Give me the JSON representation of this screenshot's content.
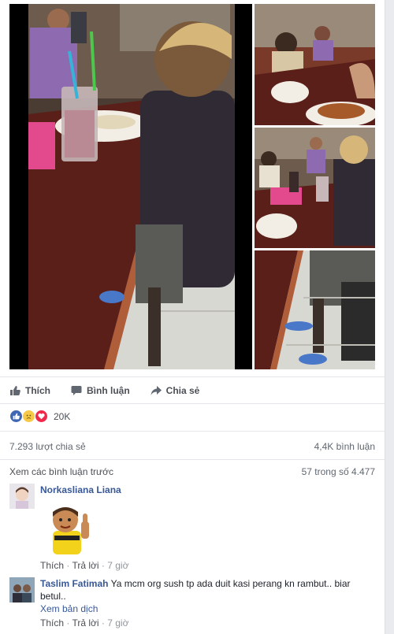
{
  "post": {
    "actions": {
      "like": "Thích",
      "comment": "Bình luận",
      "share": "Chia sẻ"
    },
    "reactions": {
      "icons": [
        "like-icon",
        "sad-icon",
        "love-icon"
      ],
      "count": "20K"
    },
    "stats": {
      "shares": "7.293 lượt chia sẻ",
      "comments": "4,4K bình luận"
    },
    "view_previous": "Xem các bình luận trước",
    "pagination": "57 trong số 4.477"
  },
  "comments": [
    {
      "name": "Norkasliana Liana",
      "text": "",
      "like": "Thích",
      "reply": "Trả lời",
      "time": "7 giờ"
    },
    {
      "name": "Taslim Fatimah",
      "text": "Ya mcm org sush tp ada duit kasi perang kn rambut.. biar betul..",
      "translate": "Xem bản dịch",
      "like": "Thích",
      "reply": "Trả lời",
      "time": "7 giờ"
    }
  ],
  "colors": {
    "link": "#385898",
    "like": "#4267b2",
    "love": "#f0284a",
    "sad": "#f7c948"
  }
}
